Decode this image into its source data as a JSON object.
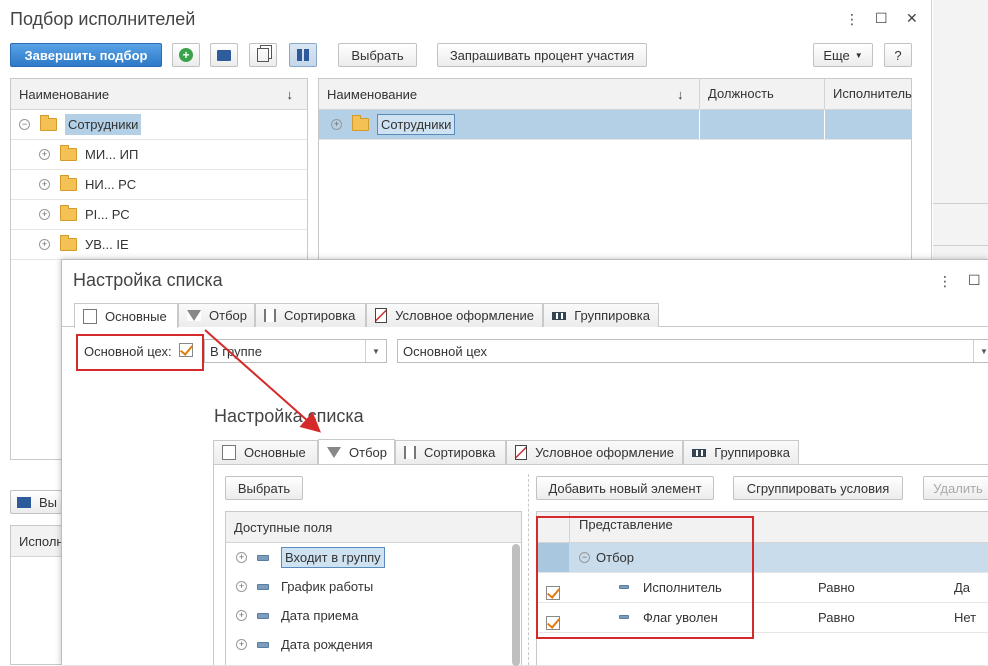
{
  "main_window": {
    "title": "Подбор исполнителей",
    "controls": {
      "more": "⋮",
      "maximize": "☐",
      "close": "✕"
    },
    "toolbar": {
      "finish_label": "Завершить подбор",
      "select_label": "Выбрать",
      "ask_percent_label": "Запрашивать процент участия",
      "more_label": "Еще",
      "help_label": "?"
    },
    "left_grid": {
      "header": "Наименование",
      "sort_arrow": "↓",
      "root": "Сотрудники",
      "items": [
        "МИ... ИП",
        "НИ... РС",
        "РI... РС",
        "УВ... IE"
      ]
    },
    "right_grid": {
      "columns": [
        "Наименование",
        "Должность",
        "Исполнитель"
      ],
      "sort_arrow": "↓",
      "root": "Сотрудники"
    },
    "bottom_left": {
      "button_label": "Вы",
      "column": "Исполн"
    }
  },
  "settings_back": {
    "title": "Настройка списка",
    "tabs": [
      "Основные",
      "Отбор",
      "Сортировка",
      "Условное оформление",
      "Группировка"
    ],
    "filter_label": "Основной цех:",
    "condition_value": "В группе",
    "value": "Основной цех"
  },
  "settings_front": {
    "title": "Настройка списка",
    "tabs": [
      "Основные",
      "Отбор",
      "Сортировка",
      "Условное оформление",
      "Группировка"
    ],
    "select_label": "Выбрать",
    "add_element_label": "Добавить новый элемент",
    "group_conditions_label": "Сгруппировать условия",
    "delete_label": "Удалить",
    "fields_header": "Доступные поля",
    "fields": [
      "Входит в группу",
      "График работы",
      "Дата приема",
      "Дата рождения"
    ],
    "conditions_header": "Представление",
    "group_row": "Отбор",
    "conditions": [
      {
        "name": "Исполнитель",
        "compare": "Равно",
        "value": "Да"
      },
      {
        "name": "Флаг уволен",
        "compare": "Равно",
        "value": "Нет"
      }
    ]
  },
  "colors": {
    "accent": "#2d79c7",
    "highlight": "#d42a2a",
    "selection": "#b4d0e6",
    "check": "#e07b12"
  }
}
